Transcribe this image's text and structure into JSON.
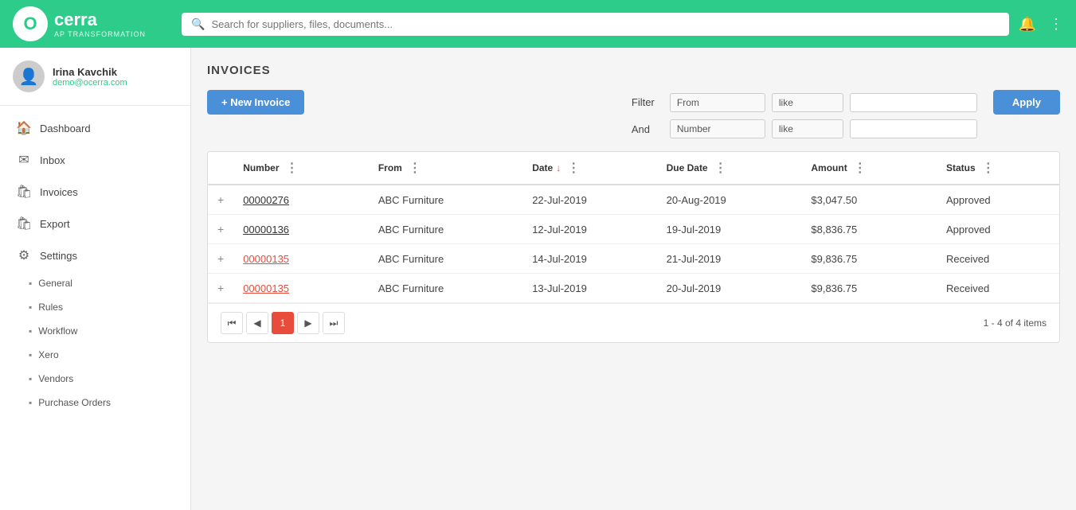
{
  "topnav": {
    "logo_letter": "O",
    "brand_name": "cerra",
    "brand_sub": "AP TRANSFORMATION",
    "search_placeholder": "Search for suppliers, files, documents..."
  },
  "sidebar": {
    "user_name": "Irina Kavchik",
    "user_email": "demo@ocerra.com",
    "nav_items": [
      {
        "id": "dashboard",
        "label": "Dashboard",
        "icon": "🏠"
      },
      {
        "id": "inbox",
        "label": "Inbox",
        "icon": "✉"
      },
      {
        "id": "invoices",
        "label": "Invoices",
        "icon": "🛍"
      },
      {
        "id": "export",
        "label": "Export",
        "icon": "🛍"
      },
      {
        "id": "settings",
        "label": "Settings",
        "icon": "⚙"
      }
    ],
    "sub_items": [
      {
        "id": "general",
        "label": "General"
      },
      {
        "id": "rules",
        "label": "Rules"
      },
      {
        "id": "workflow",
        "label": "Workflow"
      },
      {
        "id": "xero",
        "label": "Xero"
      },
      {
        "id": "vendors",
        "label": "Vendors"
      },
      {
        "id": "purchase-orders",
        "label": "Purchase Orders"
      }
    ]
  },
  "page": {
    "title": "INVOICES",
    "new_invoice_label": "+ New Invoice"
  },
  "filter": {
    "filter_label": "Filter",
    "and_label": "And",
    "row1": {
      "field": "From",
      "operator": "like",
      "value": ""
    },
    "row2": {
      "field": "Number",
      "operator": "like",
      "value": ""
    },
    "apply_label": "Apply"
  },
  "table": {
    "columns": [
      {
        "id": "expand",
        "label": ""
      },
      {
        "id": "number",
        "label": "Number"
      },
      {
        "id": "from",
        "label": "From"
      },
      {
        "id": "date",
        "label": "Date",
        "sorted": "desc"
      },
      {
        "id": "due_date",
        "label": "Due Date"
      },
      {
        "id": "amount",
        "label": "Amount"
      },
      {
        "id": "status",
        "label": "Status"
      }
    ],
    "rows": [
      {
        "id": "row1",
        "number": "00000276",
        "number_style": "black",
        "from": "ABC Furniture",
        "date": "22-Jul-2019",
        "due_date": "20-Aug-2019",
        "amount": "$3,047.50",
        "status": "Approved"
      },
      {
        "id": "row2",
        "number": "00000136",
        "number_style": "black",
        "from": "ABC Furniture",
        "date": "12-Jul-2019",
        "due_date": "19-Jul-2019",
        "amount": "$8,836.75",
        "status": "Approved"
      },
      {
        "id": "row3",
        "number": "00000135",
        "number_style": "red",
        "from": "ABC Furniture",
        "date": "14-Jul-2019",
        "due_date": "21-Jul-2019",
        "amount": "$9,836.75",
        "status": "Received"
      },
      {
        "id": "row4",
        "number": "00000135",
        "number_style": "red",
        "from": "ABC Furniture",
        "date": "13-Jul-2019",
        "due_date": "20-Jul-2019",
        "amount": "$9,836.75",
        "status": "Received"
      }
    ]
  },
  "pagination": {
    "current_page": 1,
    "summary": "1 - 4 of 4 items"
  }
}
